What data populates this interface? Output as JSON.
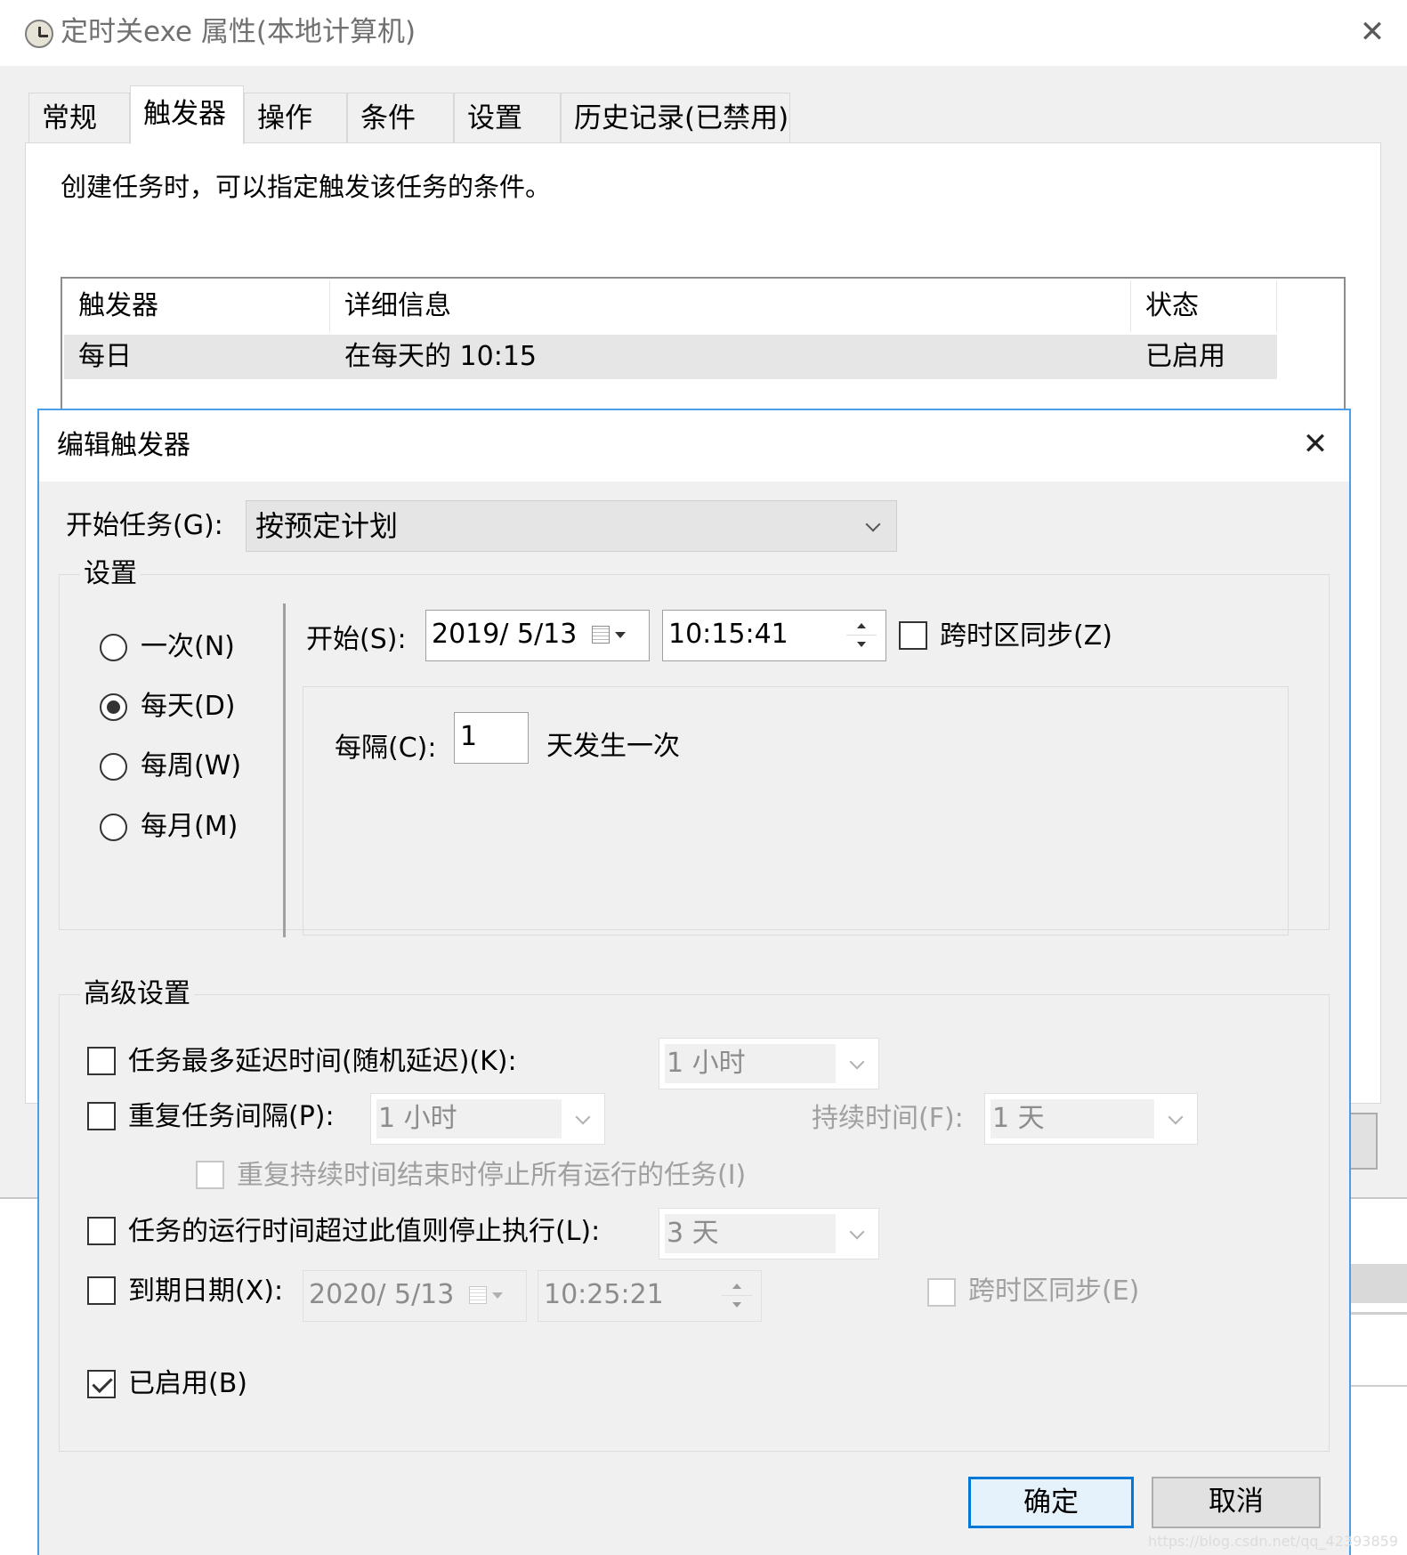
{
  "props_window": {
    "title": "定时关exe 属性(本地计算机)",
    "tabs": [
      "常规",
      "触发器",
      "操作",
      "条件",
      "设置",
      "历史记录(已禁用)"
    ],
    "active_tab": "触发器",
    "description": "创建任务时，可以指定触发该任务的条件。",
    "table": {
      "headers": [
        "触发器",
        "详细信息",
        "状态"
      ],
      "rows": [
        {
          "trigger": "每日",
          "details": "在每天的 10:15",
          "status": "已启用"
        }
      ]
    }
  },
  "edit_dialog": {
    "title": "编辑触发器",
    "begin_label": "开始任务(G):",
    "begin_value": "按预定计划",
    "settings_label": "设置",
    "schedule_options": [
      {
        "label": "一次(N)",
        "checked": false
      },
      {
        "label": "每天(D)",
        "checked": true
      },
      {
        "label": "每周(W)",
        "checked": false
      },
      {
        "label": "每月(M)",
        "checked": false
      }
    ],
    "start_label": "开始(S):",
    "start_date": "2019/  5/13",
    "start_time": "10:15:41",
    "sync_tz_label": "跨时区同步(Z)",
    "recur_label": "每隔(C):",
    "recur_value": "1",
    "recur_suffix": "天发生一次",
    "advanced_label": "高级设置",
    "delay_label": "任务最多延迟时间(随机延迟)(K):",
    "delay_value": "1 小时",
    "repeat_label": "重复任务间隔(P):",
    "repeat_value": "1 小时",
    "duration_label": "持续时间(F):",
    "duration_value": "1 天",
    "stop_at_end_label": "重复持续时间结束时停止所有运行的任务(I)",
    "stop_if_longer_label": "任务的运行时间超过此值则停止执行(L):",
    "stop_if_longer_value": "3 天",
    "expire_label": "到期日期(X):",
    "expire_date": "2020/  5/13",
    "expire_time": "10:25:21",
    "expire_sync_label": "跨时区同步(E)",
    "enabled_label": "已启用(B)",
    "enabled_checked": true,
    "ok_label": "确定",
    "cancel_label": "取消"
  },
  "watermark": "https://blog.csdn.net/qq_42393859"
}
